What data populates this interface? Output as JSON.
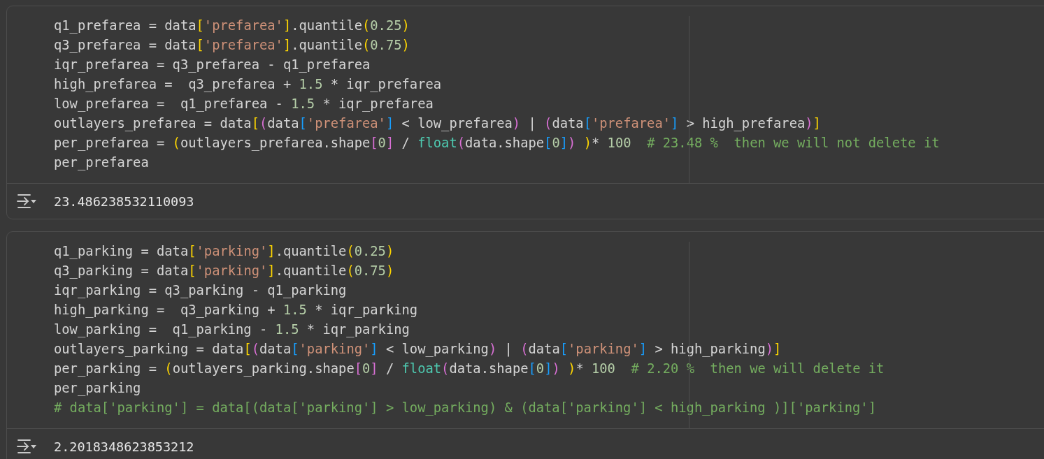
{
  "cells": [
    {
      "lines": [
        [
          {
            "kind": "plain",
            "text": "q1_prefarea = data"
          },
          {
            "kind": "bracket1",
            "text": "["
          },
          {
            "kind": "string",
            "text": "'prefarea'"
          },
          {
            "kind": "bracket1",
            "text": "]"
          },
          {
            "kind": "plain",
            "text": ".quantile"
          },
          {
            "kind": "bracket1",
            "text": "("
          },
          {
            "kind": "number",
            "text": "0.25"
          },
          {
            "kind": "bracket1",
            "text": ")"
          }
        ],
        [
          {
            "kind": "plain",
            "text": "q3_prefarea = data"
          },
          {
            "kind": "bracket1",
            "text": "["
          },
          {
            "kind": "string",
            "text": "'prefarea'"
          },
          {
            "kind": "bracket1",
            "text": "]"
          },
          {
            "kind": "plain",
            "text": ".quantile"
          },
          {
            "kind": "bracket1",
            "text": "("
          },
          {
            "kind": "number",
            "text": "0.75"
          },
          {
            "kind": "bracket1",
            "text": ")"
          }
        ],
        [
          {
            "kind": "plain",
            "text": "iqr_prefarea = q3_prefarea - q1_prefarea"
          }
        ],
        [
          {
            "kind": "plain",
            "text": "high_prefarea =  q3_prefarea + "
          },
          {
            "kind": "number",
            "text": "1.5"
          },
          {
            "kind": "plain",
            "text": " * iqr_prefarea"
          }
        ],
        [
          {
            "kind": "plain",
            "text": "low_prefarea =  q1_prefarea - "
          },
          {
            "kind": "number",
            "text": "1.5"
          },
          {
            "kind": "plain",
            "text": " * iqr_prefarea"
          }
        ],
        [
          {
            "kind": "plain",
            "text": "outlayers_prefarea = data"
          },
          {
            "kind": "bracket1",
            "text": "["
          },
          {
            "kind": "bracket2",
            "text": "("
          },
          {
            "kind": "plain",
            "text": "data"
          },
          {
            "kind": "bracket3",
            "text": "["
          },
          {
            "kind": "string",
            "text": "'prefarea'"
          },
          {
            "kind": "bracket3",
            "text": "]"
          },
          {
            "kind": "plain",
            "text": " < low_prefarea"
          },
          {
            "kind": "bracket2",
            "text": ")"
          },
          {
            "kind": "plain",
            "text": " | "
          },
          {
            "kind": "bracket2",
            "text": "("
          },
          {
            "kind": "plain",
            "text": "data"
          },
          {
            "kind": "bracket3",
            "text": "["
          },
          {
            "kind": "string",
            "text": "'prefarea'"
          },
          {
            "kind": "bracket3",
            "text": "]"
          },
          {
            "kind": "plain",
            "text": " > high_prefarea"
          },
          {
            "kind": "bracket2",
            "text": ")"
          },
          {
            "kind": "bracket1",
            "text": "]"
          }
        ],
        [
          {
            "kind": "plain",
            "text": "per_prefarea = "
          },
          {
            "kind": "bracket1",
            "text": "("
          },
          {
            "kind": "plain",
            "text": "outlayers_prefarea.shape"
          },
          {
            "kind": "bracket2",
            "text": "["
          },
          {
            "kind": "number",
            "text": "0"
          },
          {
            "kind": "bracket2",
            "text": "]"
          },
          {
            "kind": "plain",
            "text": " / "
          },
          {
            "kind": "builtin",
            "text": "float"
          },
          {
            "kind": "bracket2",
            "text": "("
          },
          {
            "kind": "plain",
            "text": "data.shape"
          },
          {
            "kind": "bracket3",
            "text": "["
          },
          {
            "kind": "number",
            "text": "0"
          },
          {
            "kind": "bracket3",
            "text": "]"
          },
          {
            "kind": "bracket2",
            "text": ")"
          },
          {
            "kind": "bracket1",
            "text": " )"
          },
          {
            "kind": "plain",
            "text": "* "
          },
          {
            "kind": "number",
            "text": "100  "
          },
          {
            "kind": "comment",
            "text": "# 23.48 %  then we will not delete it"
          }
        ],
        [
          {
            "kind": "plain",
            "text": "per_prefarea"
          }
        ]
      ],
      "output": "23.486238532110093"
    },
    {
      "lines": [
        [
          {
            "kind": "plain",
            "text": "q1_parking = data"
          },
          {
            "kind": "bracket1",
            "text": "["
          },
          {
            "kind": "string",
            "text": "'parking'"
          },
          {
            "kind": "bracket1",
            "text": "]"
          },
          {
            "kind": "plain",
            "text": ".quantile"
          },
          {
            "kind": "bracket1",
            "text": "("
          },
          {
            "kind": "number",
            "text": "0.25"
          },
          {
            "kind": "bracket1",
            "text": ")"
          }
        ],
        [
          {
            "kind": "plain",
            "text": "q3_parking = data"
          },
          {
            "kind": "bracket1",
            "text": "["
          },
          {
            "kind": "string",
            "text": "'parking'"
          },
          {
            "kind": "bracket1",
            "text": "]"
          },
          {
            "kind": "plain",
            "text": ".quantile"
          },
          {
            "kind": "bracket1",
            "text": "("
          },
          {
            "kind": "number",
            "text": "0.75"
          },
          {
            "kind": "bracket1",
            "text": ")"
          }
        ],
        [
          {
            "kind": "plain",
            "text": "iqr_parking = q3_parking - q1_parking"
          }
        ],
        [
          {
            "kind": "plain",
            "text": "high_parking =  q3_parking + "
          },
          {
            "kind": "number",
            "text": "1.5"
          },
          {
            "kind": "plain",
            "text": " * iqr_parking"
          }
        ],
        [
          {
            "kind": "plain",
            "text": "low_parking =  q1_parking - "
          },
          {
            "kind": "number",
            "text": "1.5"
          },
          {
            "kind": "plain",
            "text": " * iqr_parking"
          }
        ],
        [
          {
            "kind": "plain",
            "text": "outlayers_parking = data"
          },
          {
            "kind": "bracket1",
            "text": "["
          },
          {
            "kind": "bracket2",
            "text": "("
          },
          {
            "kind": "plain",
            "text": "data"
          },
          {
            "kind": "bracket3",
            "text": "["
          },
          {
            "kind": "string",
            "text": "'parking'"
          },
          {
            "kind": "bracket3",
            "text": "]"
          },
          {
            "kind": "plain",
            "text": " < low_parking"
          },
          {
            "kind": "bracket2",
            "text": ")"
          },
          {
            "kind": "plain",
            "text": " | "
          },
          {
            "kind": "bracket2",
            "text": "("
          },
          {
            "kind": "plain",
            "text": "data"
          },
          {
            "kind": "bracket3",
            "text": "["
          },
          {
            "kind": "string",
            "text": "'parking'"
          },
          {
            "kind": "bracket3",
            "text": "]"
          },
          {
            "kind": "plain",
            "text": " > high_parking"
          },
          {
            "kind": "bracket2",
            "text": ")"
          },
          {
            "kind": "bracket1",
            "text": "]"
          }
        ],
        [
          {
            "kind": "plain",
            "text": "per_parking = "
          },
          {
            "kind": "bracket1",
            "text": "("
          },
          {
            "kind": "plain",
            "text": "outlayers_parking.shape"
          },
          {
            "kind": "bracket2",
            "text": "["
          },
          {
            "kind": "number",
            "text": "0"
          },
          {
            "kind": "bracket2",
            "text": "]"
          },
          {
            "kind": "plain",
            "text": " / "
          },
          {
            "kind": "builtin",
            "text": "float"
          },
          {
            "kind": "bracket2",
            "text": "("
          },
          {
            "kind": "plain",
            "text": "data.shape"
          },
          {
            "kind": "bracket3",
            "text": "["
          },
          {
            "kind": "number",
            "text": "0"
          },
          {
            "kind": "bracket3",
            "text": "]"
          },
          {
            "kind": "bracket2",
            "text": ")"
          },
          {
            "kind": "bracket1",
            "text": " )"
          },
          {
            "kind": "plain",
            "text": "* "
          },
          {
            "kind": "number",
            "text": "100  "
          },
          {
            "kind": "comment",
            "text": "# 2.20 %  then we will delete it"
          }
        ],
        [
          {
            "kind": "plain",
            "text": "per_parking"
          }
        ],
        [
          {
            "kind": "comment",
            "text": "# data['parking'] = data[(data['parking'] > low_parking) & (data['parking'] < high_parking )]['parking']"
          }
        ]
      ],
      "output": "2.2018348623853212"
    }
  ]
}
